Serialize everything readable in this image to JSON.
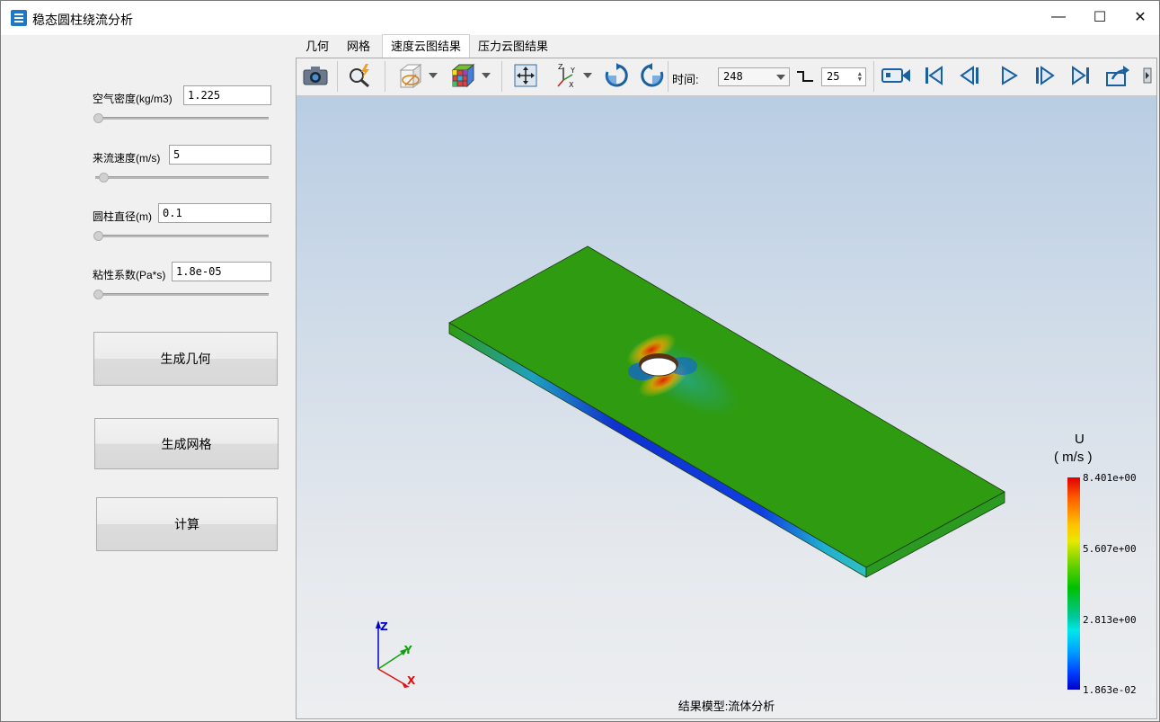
{
  "window": {
    "title": "稳态圆柱绕流分析",
    "minimize": "—",
    "maximize": "☐",
    "close": "✕"
  },
  "params": [
    {
      "label": "空气密度(kg/m3)",
      "value": "1.225"
    },
    {
      "label": "来流速度(m/s)",
      "value": "5"
    },
    {
      "label": "圆柱直径(m)",
      "value": "0.1"
    },
    {
      "label": "粘性系数(Pa*s)",
      "value": "1.8e-05"
    }
  ],
  "buttons": {
    "geometry": "生成几何",
    "mesh": "生成网格",
    "compute": "计算"
  },
  "tabs": [
    {
      "label": "几何",
      "active": false
    },
    {
      "label": "网格",
      "active": false
    },
    {
      "label": "速度云图结果",
      "active": true
    },
    {
      "label": "压力云图结果",
      "active": false
    }
  ],
  "toolbar": {
    "time_label": "时间:",
    "time_value": "248",
    "step_value": "25",
    "icons": [
      "camera-icon",
      "zoom-lightning-icon",
      "clip-plane-icon",
      "color-cube-icon",
      "fit-view-icon",
      "axes-icon",
      "rotate-cw-icon",
      "rotate-ccw-icon",
      "record-icon",
      "first-frame-icon",
      "prev-frame-icon",
      "play-icon",
      "next-frame-icon",
      "last-frame-icon",
      "export-icon"
    ]
  },
  "viewport": {
    "legend": {
      "title": "U",
      "unit": "( m/s )",
      "ticks": [
        "8.401e+00",
        "5.607e+00",
        "2.813e+00",
        "1.863e-02"
      ]
    },
    "axes": {
      "z": "Z",
      "y": "Y",
      "x": "X"
    },
    "status": "结果模型:流体分析"
  },
  "colors": {
    "model_green": "#2e9b10",
    "window_bg": "#f0f0f0",
    "colorbar_max": "#e00000",
    "colorbar_min": "#0000c8"
  }
}
